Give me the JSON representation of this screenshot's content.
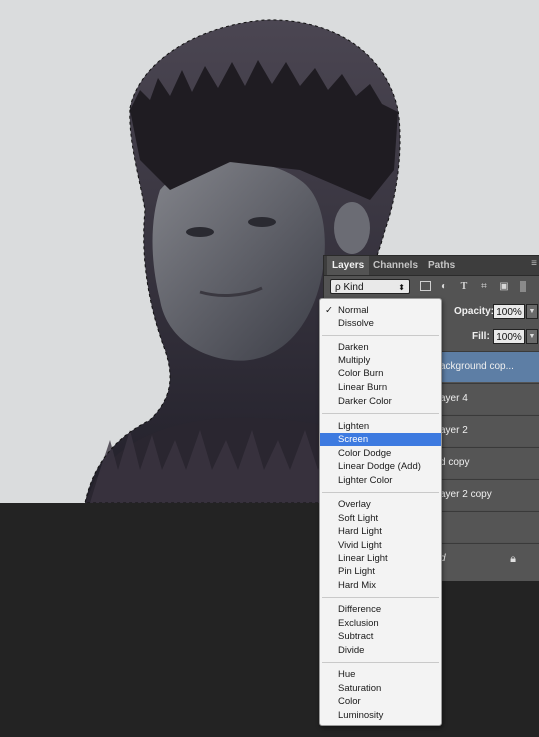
{
  "layers_panel": {
    "tabs": [
      {
        "label": "Layers",
        "active": true
      },
      {
        "label": "Channels",
        "active": false
      },
      {
        "label": "Paths",
        "active": false
      }
    ],
    "panel_menu_icon": "panel-menu-icon",
    "filter": {
      "kind_label": "Kind",
      "search_glyph": "ρ",
      "icons": [
        "image-filter-icon",
        "adjustment-filter-icon",
        "type-filter-icon",
        "shape-filter-icon",
        "smart-object-filter-icon"
      ]
    },
    "opacity": {
      "label": "Opacity:",
      "value": "100%"
    },
    "fill": {
      "label": "Fill:",
      "value": "100%"
    },
    "layers": [
      {
        "name": "ackground cop...",
        "selected": true
      },
      {
        "name": "ayer 4",
        "selected": false
      },
      {
        "name": "ayer 2",
        "selected": false
      },
      {
        "name": "d copy",
        "selected": false
      },
      {
        "name": "ayer 2 copy",
        "selected": false
      },
      {
        "name": "",
        "selected": false
      },
      {
        "name": "d",
        "selected": false,
        "locked": true
      }
    ]
  },
  "blend_menu": {
    "selected": "Normal",
    "highlighted": "Screen",
    "groups": [
      [
        "Normal",
        "Dissolve"
      ],
      [
        "Darken",
        "Multiply",
        "Color Burn",
        "Linear Burn",
        "Darker Color"
      ],
      [
        "Lighten",
        "Screen",
        "Color Dodge",
        "Linear Dodge (Add)",
        "Lighter Color"
      ],
      [
        "Overlay",
        "Soft Light",
        "Hard Light",
        "Vivid Light",
        "Linear Light",
        "Pin Light",
        "Hard Mix"
      ],
      [
        "Difference",
        "Exclusion",
        "Subtract",
        "Divide"
      ],
      [
        "Hue",
        "Saturation",
        "Color",
        "Luminosity"
      ]
    ]
  },
  "colors": {
    "canvas_bg": "#dadcdd",
    "workspace_dark": "#232323",
    "panel_bg": "#535353",
    "selected_layer": "#5d7ea5",
    "menu_highlight": "#3d7ae0"
  }
}
